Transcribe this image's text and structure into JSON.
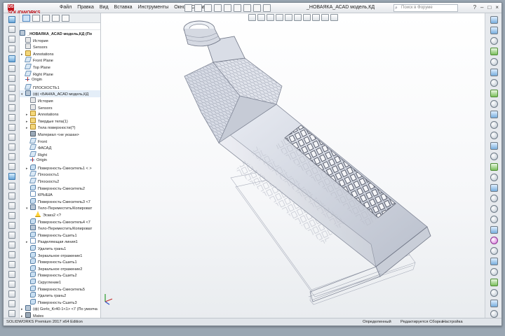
{
  "app": {
    "brand": "SOLIDWORKS",
    "brand_prefix": "DS",
    "document_title": "_НОВАЯКА_АСАD модель,КД",
    "search_placeholder": "Поиск в Форуме"
  },
  "menu": [
    "Файл",
    "Правка",
    "Вид",
    "Вставка",
    "Инструменты",
    "Окно",
    "Справка"
  ],
  "tree": {
    "root": "_НОВАЯКА_АСАD модель,КД (По",
    "nodes": [
      {
        "label": "История",
        "icon": "history-icon",
        "indent": 1,
        "exp": ""
      },
      {
        "label": "Sensors",
        "icon": "sensor-icon",
        "indent": 1,
        "exp": ""
      },
      {
        "label": "Annotations",
        "icon": "annotation-icon",
        "indent": 1,
        "exp": "▸"
      },
      {
        "label": "Front Plane",
        "icon": "plane-icon",
        "indent": 1,
        "exp": ""
      },
      {
        "label": "Top Plane",
        "icon": "plane-icon",
        "indent": 1,
        "exp": ""
      },
      {
        "label": "Right Plane",
        "icon": "plane-icon",
        "indent": 1,
        "exp": ""
      },
      {
        "label": "Origin",
        "icon": "origin-icon",
        "indent": 1,
        "exp": ""
      },
      {
        "label": "ПЛОСКОСТЬ1",
        "icon": "plane-icon",
        "indent": 1,
        "exp": ""
      },
      {
        "label": "(ф) <БАНКА_АСАD модель,КД",
        "icon": "part-icon",
        "indent": 1,
        "exp": "▾"
      },
      {
        "label": "История",
        "icon": "history-icon",
        "indent": 2,
        "exp": ""
      },
      {
        "label": "Sensors",
        "icon": "sensor-icon",
        "indent": 2,
        "exp": ""
      },
      {
        "label": "Annotations",
        "icon": "annotation-icon",
        "indent": 2,
        "exp": "▸"
      },
      {
        "label": "Твердые тела(1)",
        "icon": "folder-icon",
        "indent": 2,
        "exp": "▸"
      },
      {
        "label": "Тела поверхности(?)",
        "icon": "folder-icon",
        "indent": 2,
        "exp": "▸"
      },
      {
        "label": "Материал <не указан>",
        "icon": "material-icon",
        "indent": 2,
        "exp": ""
      },
      {
        "label": "Front",
        "icon": "plane-icon",
        "indent": 2,
        "exp": ""
      },
      {
        "label": "ФАСАД",
        "icon": "plane-icon",
        "indent": 2,
        "exp": ""
      },
      {
        "label": "Right",
        "icon": "plane-icon",
        "indent": 2,
        "exp": ""
      },
      {
        "label": "Origin",
        "icon": "origin-icon",
        "indent": 2,
        "exp": ""
      },
      {
        "label": "Поверхность-Смеситель1 < >",
        "icon": "surface-icon",
        "indent": 2,
        "exp": "▸"
      },
      {
        "label": "Плоскость1",
        "icon": "plane-icon",
        "indent": 2,
        "exp": ""
      },
      {
        "label": "Плоскость2",
        "icon": "plane-icon",
        "indent": 2,
        "exp": ""
      },
      {
        "label": "Поверхность-Смеситель2",
        "icon": "surface-icon",
        "indent": 2,
        "exp": ""
      },
      {
        "label": "КРЫША",
        "icon": "sketch-icon",
        "indent": 2,
        "exp": ""
      },
      {
        "label": "Поверхность-Смеситель3 <7",
        "icon": "surface-icon",
        "indent": 2,
        "exp": ""
      },
      {
        "label": "Тело-Переместить/Копироват",
        "icon": "part-icon",
        "indent": 2,
        "exp": "▾"
      },
      {
        "label": "Эскиз2 <?",
        "icon": "warning-icon",
        "indent": 3,
        "exp": ""
      },
      {
        "label": "Поверхность-Смеситель4 <7",
        "icon": "surface-icon",
        "indent": 2,
        "exp": ""
      },
      {
        "label": "Тело-Переместить/Копироват",
        "icon": "part-icon",
        "indent": 2,
        "exp": ""
      },
      {
        "label": "Поверхность-Сшить1",
        "icon": "surface-icon",
        "indent": 2,
        "exp": ""
      },
      {
        "label": "Разделяющая линия1",
        "icon": "sketch-icon",
        "indent": 2,
        "exp": "▸"
      },
      {
        "label": "Удалить грань1",
        "icon": "surface-icon",
        "indent": 2,
        "exp": ""
      },
      {
        "label": "Зеркальное отражение1",
        "icon": "surface-icon",
        "indent": 2,
        "exp": ""
      },
      {
        "label": "Поверхность-Сшить1",
        "icon": "surface-icon",
        "indent": 2,
        "exp": ""
      },
      {
        "label": "Зеркальное отражение2",
        "icon": "surface-icon",
        "indent": 2,
        "exp": ""
      },
      {
        "label": "Поверхность-Сшить2",
        "icon": "surface-icon",
        "indent": 2,
        "exp": ""
      },
      {
        "label": "Скругление1",
        "icon": "surface-icon",
        "indent": 2,
        "exp": ""
      },
      {
        "label": "Поверхность-Смеситель5",
        "icon": "surface-icon",
        "indent": 2,
        "exp": ""
      },
      {
        "label": "Удалить грань2",
        "icon": "surface-icon",
        "indent": 2,
        "exp": ""
      },
      {
        "label": "Поверхность-Сшить3",
        "icon": "surface-icon",
        "indent": 2,
        "exp": ""
      },
      {
        "label": "(ф) Gorlo_Kr40-1<1> <7 (По умолча",
        "icon": "part-icon",
        "indent": 1,
        "exp": "▸"
      },
      {
        "label": "Mates",
        "icon": "mates-icon",
        "indent": 1,
        "exp": "▸"
      }
    ]
  },
  "status": {
    "edition": "SOLIDWORKS Premium 2017 x64 Edition",
    "state": "Определенный",
    "edit_mode": "Редактируется Сборка",
    "settings": "Настройка"
  }
}
